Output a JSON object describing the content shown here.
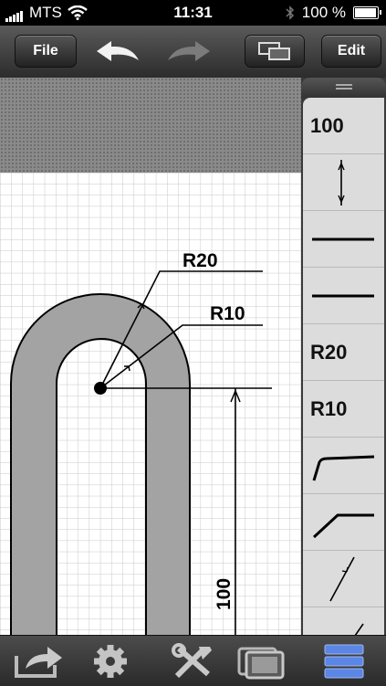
{
  "status": {
    "carrier": "MTS",
    "time": "11:31",
    "battery": "100 %"
  },
  "toolbar": {
    "file_label": "File",
    "edit_label": "Edit"
  },
  "drawing": {
    "radius_outer_label": "R20",
    "radius_inner_label": "R10",
    "length_label": "100"
  },
  "panel": {
    "items": [
      {
        "type": "text",
        "label": "100"
      },
      {
        "type": "icon",
        "name": "vertical-dimension-icon"
      },
      {
        "type": "icon",
        "name": "thick-line-icon"
      },
      {
        "type": "icon",
        "name": "thick-line-icon"
      },
      {
        "type": "text",
        "label": "R20"
      },
      {
        "type": "text",
        "label": "R10"
      },
      {
        "type": "icon",
        "name": "corner-sharp-icon"
      },
      {
        "type": "icon",
        "name": "corner-chamfer-icon"
      },
      {
        "type": "icon",
        "name": "diagonal-dimension-icon"
      }
    ]
  },
  "colors": {
    "highlight": "#5b86e5",
    "shape_fill": "#a3a3a3"
  }
}
